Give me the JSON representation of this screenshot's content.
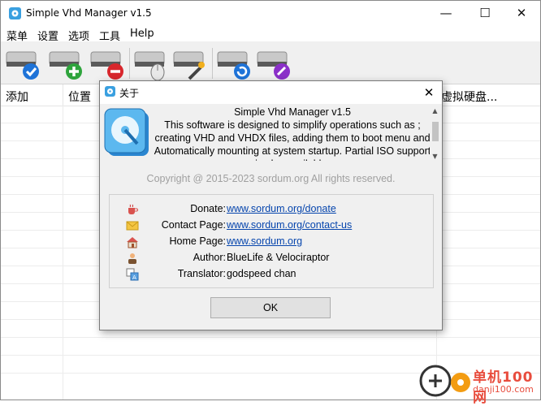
{
  "window": {
    "title": "Simple Vhd Manager v1.5"
  },
  "window_controls": {
    "minimize": "—",
    "maximize": "☐",
    "close": "✕"
  },
  "menu": [
    "菜单",
    "设置",
    "选项",
    "工具",
    "Help"
  ],
  "toolbar": {
    "buttons": [
      {
        "name": "check-drive-icon"
      },
      {
        "name": "add-drive-icon"
      },
      {
        "name": "remove-drive-icon"
      },
      {
        "name": "mouse-drive-icon"
      },
      {
        "name": "settings-drive-icon"
      },
      {
        "name": "refresh-drive-icon"
      },
      {
        "name": "link-drive-icon"
      }
    ]
  },
  "columns": [
    "添加",
    "位置",
    "虚拟硬盘..."
  ],
  "dialog": {
    "title": "关于",
    "close": "✕",
    "app_name": "Simple Vhd Manager v1.5",
    "description": "This software is designed to simplify operations such as ; creating VHD and VHDX files, adding them to boot menu and Automatically mounting at system startup. Partial ISO support is also available.",
    "copyright": "Copyright @ 2015-2023 sordum.org All rights reserved.",
    "info": {
      "donate_label": "Donate:",
      "donate_value": "www.sordum.org/donate",
      "contact_label": "Contact Page:",
      "contact_value": "www.sordum.org/contact-us",
      "home_label": "Home Page:",
      "home_value": "www.sordum.org",
      "author_label": "Author:",
      "author_value": "BlueLife & Velociraptor",
      "translator_label": "Translator:",
      "translator_value": "godspeed chan"
    },
    "ok_label": "OK"
  },
  "watermark": {
    "brand": "单机100网",
    "url": "danji100.com"
  },
  "colors": {
    "link": "#0645ad",
    "accent_blue": "#1a73e8",
    "watermark": "#e84c3d"
  }
}
